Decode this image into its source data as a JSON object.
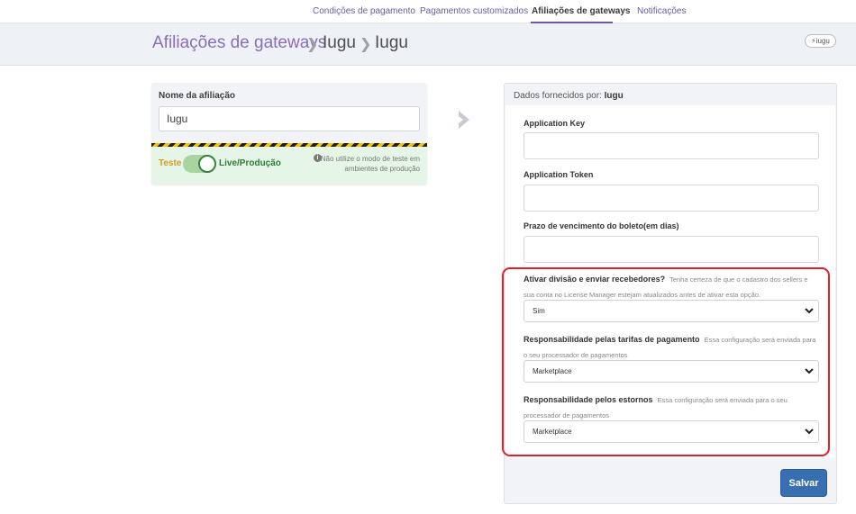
{
  "nav": {
    "tabs": [
      {
        "label": "Condições de pagamento"
      },
      {
        "label": "Pagamentos customizados"
      },
      {
        "label": "Afiliações de gateways"
      },
      {
        "label": "Notificações"
      }
    ],
    "active_index": 2
  },
  "header": {
    "breadcrumb": [
      "Afiliações de gateways",
      "Iugu",
      "Iugu"
    ],
    "badge": "iugu"
  },
  "affiliation": {
    "name_label": "Nome da afiliação",
    "name_value": "Iugu",
    "env_test": "Teste",
    "env_live": "Live/Produção",
    "env_live_active": true,
    "warning": "Não utilize o modo de teste em ambientes de produção"
  },
  "provider": {
    "title_prefix": "Dados fornecidos por:",
    "title_name": "Iugu",
    "fields": [
      {
        "label": "Application Key",
        "value": ""
      },
      {
        "label": "Application Token",
        "value": ""
      },
      {
        "label": "Prazo de vencimento do boleto(em dias)",
        "value": ""
      }
    ],
    "selects": [
      {
        "label": "Ativar divisão e enviar recebedores?",
        "hint": "Tenha certeza de que o cadastro dos sellers e sua conta no License Manager estejam atualizados antes de ativar esta opção.",
        "value": "Sim"
      },
      {
        "label": "Responsabilidade pelas tarifas de pagamento",
        "hint": "Essa configuração será enviada para o seu processador de pagamentos",
        "value": "Marketplace"
      },
      {
        "label": "Responsabilidade pelos estornos",
        "hint": "Essa configuração será enviada para o seu processador de pagamentos",
        "value": "Marketplace"
      }
    ],
    "save_label": "Salvar"
  },
  "colors": {
    "brand_purple": "#8b6eb5",
    "save_blue": "#386fb1",
    "highlight_red": "#e0202a",
    "live_green": "#2e7b31",
    "test_orange": "#d59b1e"
  },
  "icons": [
    "chevron-right-icon",
    "chevron-down-icon",
    "info-icon",
    "iugu-logo"
  ]
}
